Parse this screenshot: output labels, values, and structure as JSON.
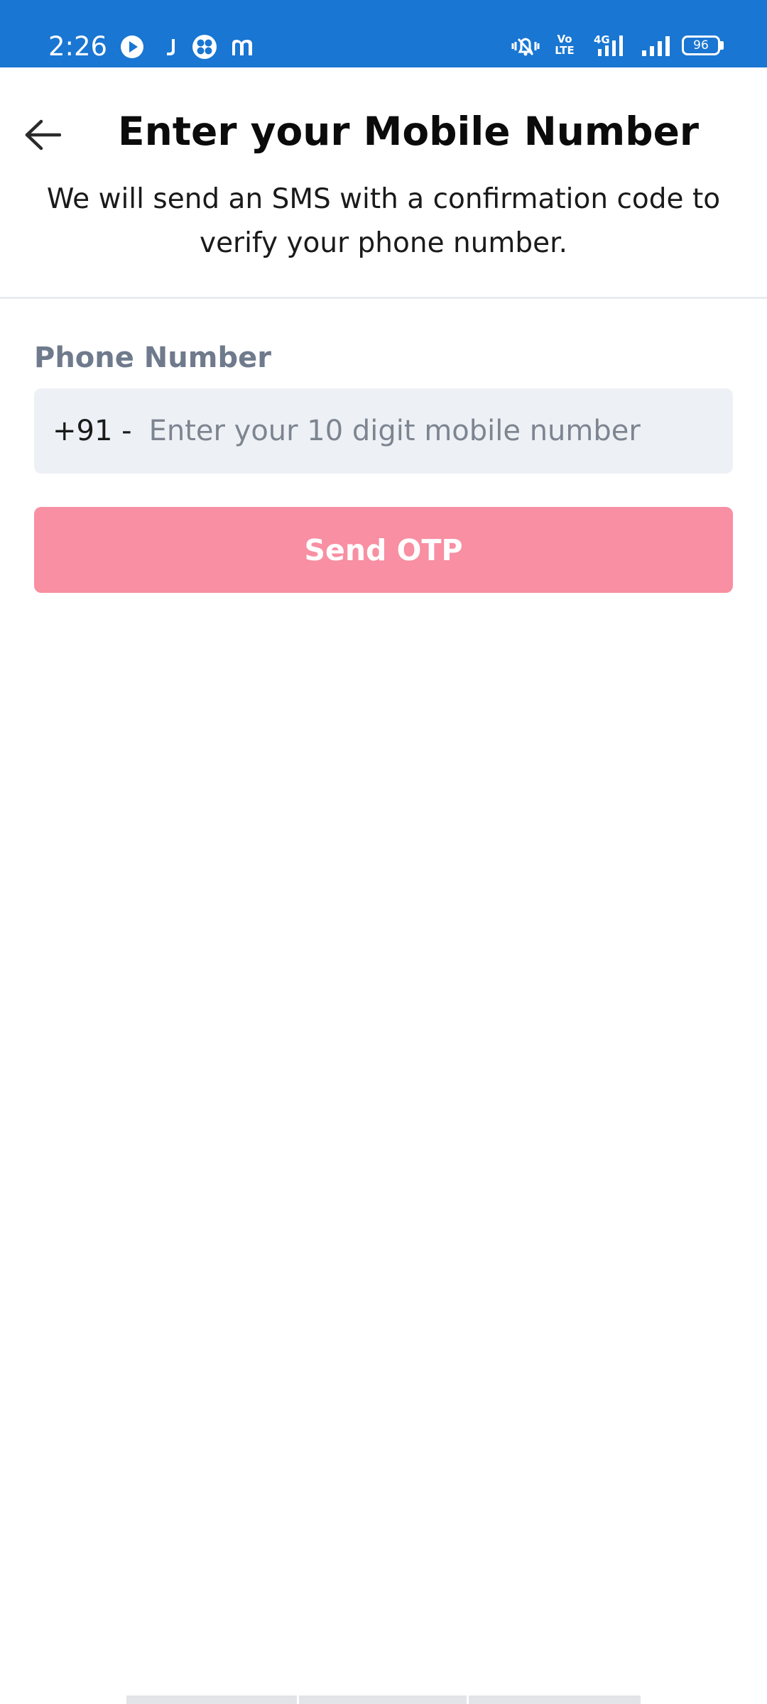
{
  "status_bar": {
    "time": "2:26",
    "battery": "96",
    "network_label": "4G",
    "volte_label": "Vo LTE",
    "background_color": "#1976d2",
    "left_icons": [
      "play-icon",
      "j-notification-icon",
      "clover-icon",
      "m-notification-icon"
    ],
    "right_icons": [
      "vibrate-mute-icon",
      "volte-icon",
      "signal-4g-icon",
      "signal-icon",
      "battery-icon"
    ]
  },
  "header": {
    "title": "Enter your Mobile Number",
    "subtitle": "We will send an SMS with a confirmation code to verify your phone number.",
    "back_icon": "arrow-left-icon"
  },
  "form": {
    "phone_label": "Phone Number",
    "country_code": "+91 -",
    "phone_placeholder": "Enter your 10 digit mobile number",
    "phone_value": "",
    "submit_label": "Send OTP",
    "submit_color": "#f88fa2"
  }
}
